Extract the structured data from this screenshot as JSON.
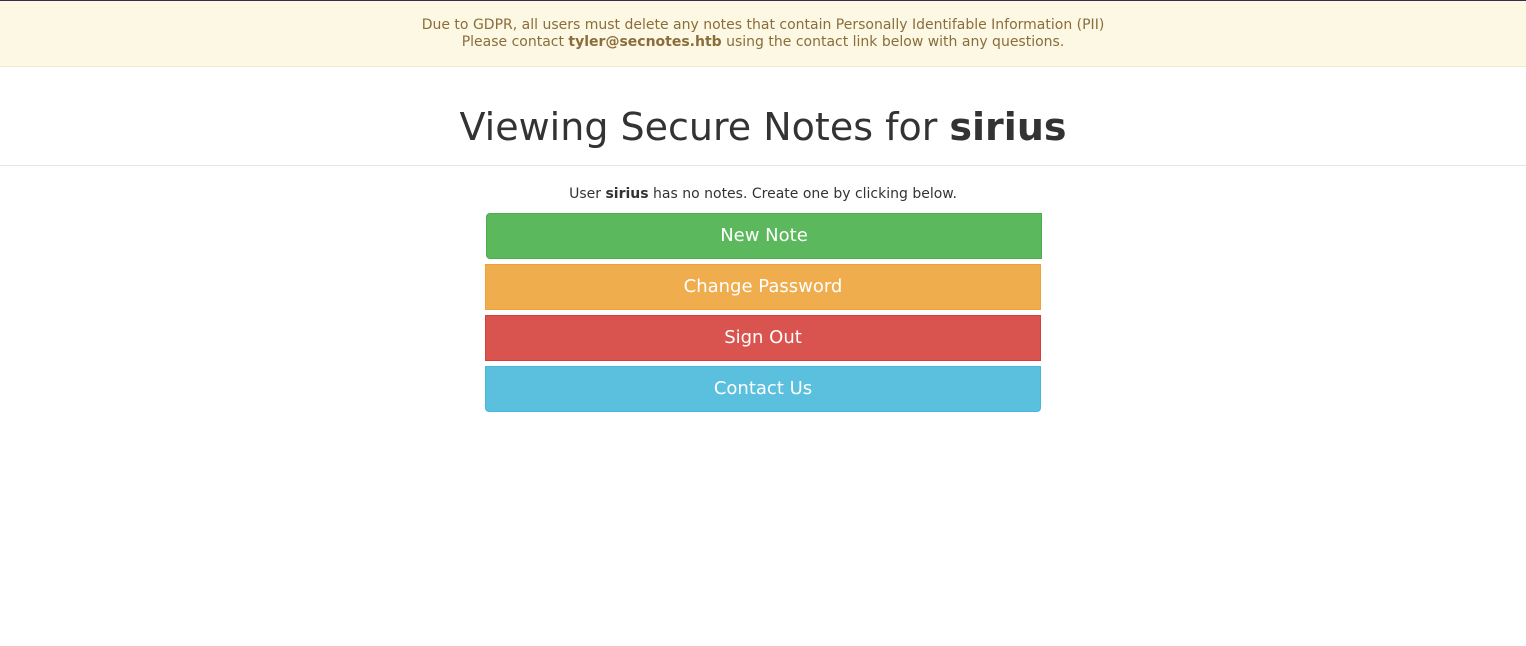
{
  "notice": {
    "line1": "Due to GDPR, all users must delete any notes that contain Personally Identifable Information (PII)",
    "line2_prefix": "Please contact ",
    "line2_email": "tyler@secnotes.htb",
    "line2_suffix": " using the contact link below with any questions."
  },
  "header": {
    "title_prefix": "Viewing Secure Notes for ",
    "username": "sirius"
  },
  "main": {
    "empty_prefix": "User ",
    "username": "sirius",
    "empty_suffix": " has no notes. Create one by clicking below.",
    "buttons": {
      "new_note": "New Note",
      "change_password": "Change Password",
      "sign_out": "Sign Out",
      "contact_us": "Contact Us"
    }
  },
  "colors": {
    "notice_bg": "#fcf8e3",
    "notice_text": "#8a6d3b",
    "success": "#5cb85c",
    "warning": "#f0ad4e",
    "danger": "#d9534f",
    "info": "#5bc0de"
  }
}
